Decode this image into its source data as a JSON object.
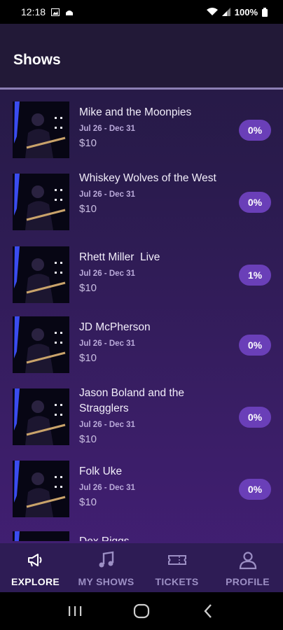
{
  "status_bar": {
    "time": "12:18",
    "battery": "100%"
  },
  "page": {
    "title": "Shows"
  },
  "shows": [
    {
      "title": "Mike and the Moonpies",
      "dates": "Jul 26 - Dec 31",
      "price": "$10",
      "percent": "0%"
    },
    {
      "title": "Whiskey Wolves of the West",
      "dates": "Jul 26 - Dec 31",
      "price": "$10",
      "percent": "0%"
    },
    {
      "title": "Rhett Miller  Live",
      "dates": "Jul 26 - Dec 31",
      "price": "$10",
      "percent": "1%"
    },
    {
      "title": "JD McPherson",
      "dates": "Jul 26 - Dec 31",
      "price": "$10",
      "percent": "0%"
    },
    {
      "title": "Jason Boland and the Stragglers",
      "dates": "Jul 26 - Dec 31",
      "price": "$10",
      "percent": "0%"
    },
    {
      "title": "Folk Uke",
      "dates": "Jul 26 - Dec 31",
      "price": "$10",
      "percent": "0%"
    },
    {
      "title": "Dex Riggs",
      "dates": "",
      "price": "",
      "percent": ""
    }
  ],
  "nav": [
    {
      "label": "EXPLORE",
      "icon": "megaphone-icon",
      "active": true
    },
    {
      "label": "MY SHOWS",
      "icon": "music-note-icon",
      "active": false
    },
    {
      "label": "TICKETS",
      "icon": "ticket-icon",
      "active": false
    },
    {
      "label": "PROFILE",
      "icon": "user-icon",
      "active": false
    }
  ],
  "colors": {
    "accent": "#6a3fb8",
    "background": "#2b1b4f",
    "nav_bg": "#2e1c55"
  }
}
